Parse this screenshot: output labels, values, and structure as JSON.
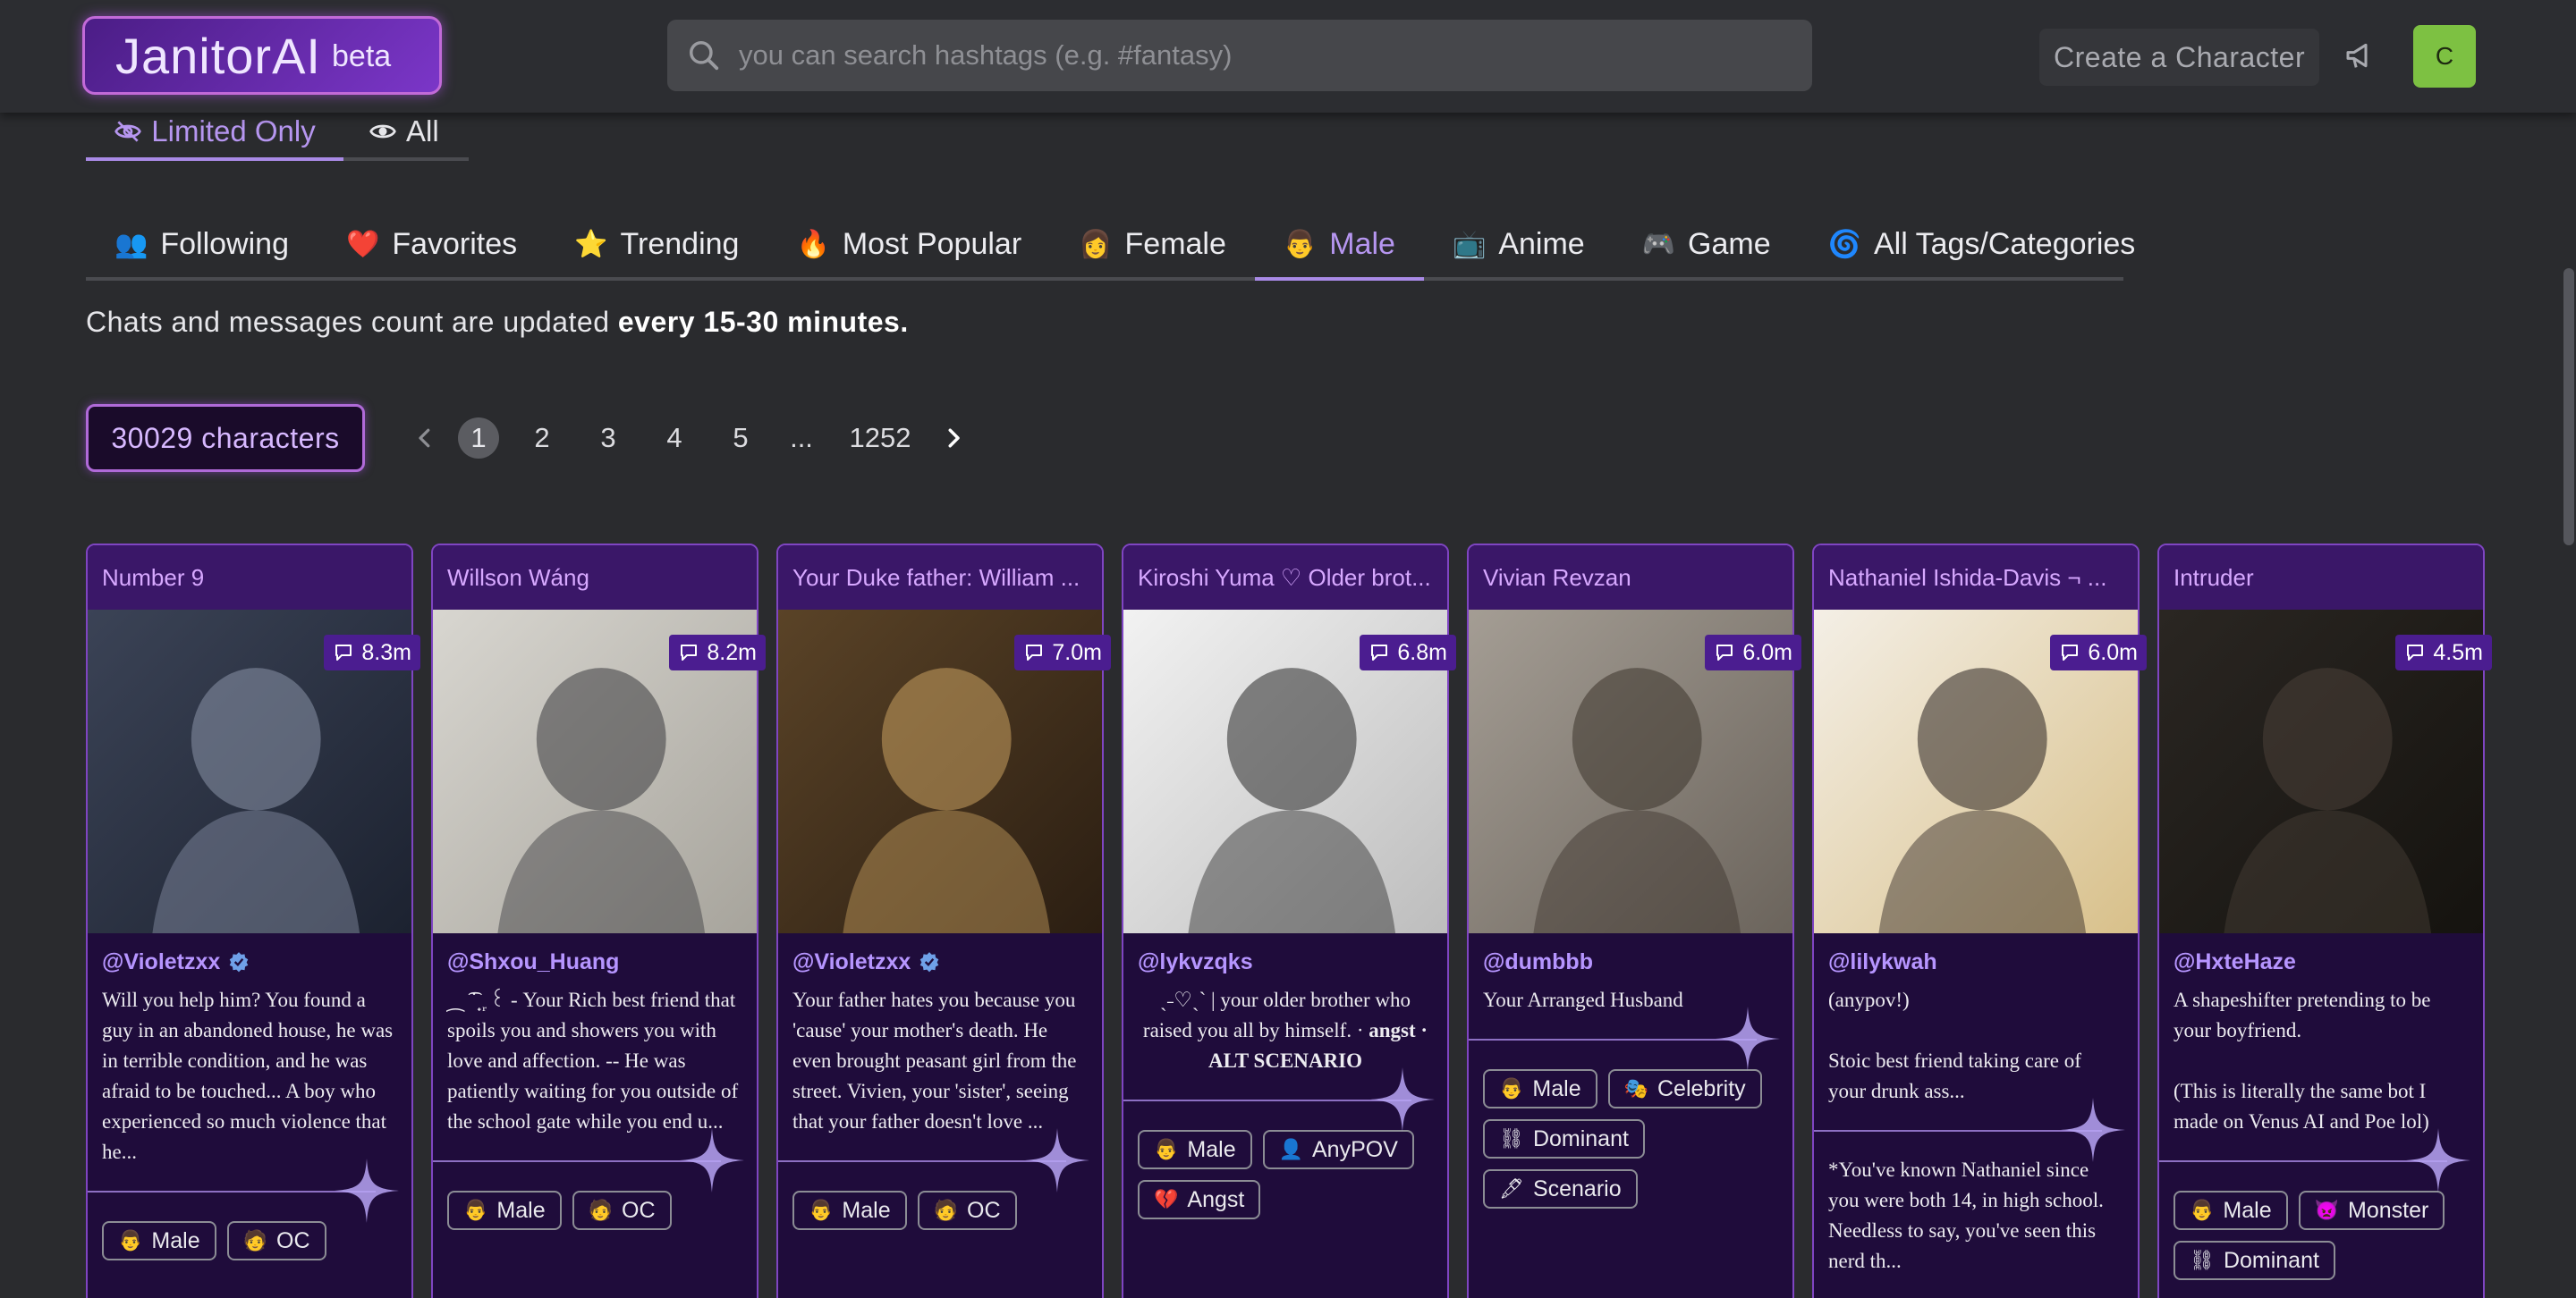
{
  "header": {
    "logo_name": "JanitorAI",
    "logo_beta": "beta",
    "search_placeholder": "you can search hashtags (e.g. #fantasy)",
    "create_label": "Create a Character",
    "avatar_letter": "C"
  },
  "limit_tabs": {
    "limited": "Limited Only",
    "all": "All"
  },
  "category_tabs": [
    {
      "emoji": "👥",
      "label": "Following"
    },
    {
      "emoji": "❤️",
      "label": "Favorites"
    },
    {
      "emoji": "⭐",
      "label": "Trending"
    },
    {
      "emoji": "🔥",
      "label": "Most Popular"
    },
    {
      "emoji": "👩",
      "label": "Female"
    },
    {
      "emoji": "👨",
      "label": "Male"
    },
    {
      "emoji": "📺",
      "label": "Anime"
    },
    {
      "emoji": "🎮",
      "label": "Game"
    },
    {
      "emoji": "🌀",
      "label": "All Tags/Categories"
    }
  ],
  "active_tab": "Male",
  "update_note": {
    "prefix": "Chats and messages count are updated ",
    "bold": "every 15-30 minutes."
  },
  "characters_count": "30029 characters",
  "pagination": {
    "pages": [
      "1",
      "2",
      "3",
      "4",
      "5",
      "...",
      "1252"
    ],
    "current": "1"
  },
  "cards": [
    {
      "name": "Number 9",
      "count": "8.3m",
      "creator": "@Violetzxx",
      "verified": true,
      "description": "Will you help him? You found a guy in an abandoned house, he was in terrible condition, and he was afraid to be touched... A boy who experienced so much violence that he...",
      "tags": [
        {
          "icon": "👨",
          "label": "Male"
        },
        {
          "icon": "🧑",
          "label": "OC"
        }
      ]
    },
    {
      "name": "Willson Wáng",
      "count": "8.2m",
      "creator": "@Shxou_Huang",
      "verified": false,
      "description": "⁔ ͡ ̇ ̟ ᷊ ꒰ - Your Rich best friend that spoils you and showers you with love and affection. -- He was patiently waiting for you outside of the school gate while you end u...",
      "tags": [
        {
          "icon": "👨",
          "label": "Male"
        },
        {
          "icon": "🧑",
          "label": "OC"
        }
      ]
    },
    {
      "name": "Your Duke father: William ...",
      "count": "7.0m",
      "creator": "@Violetzxx",
      "verified": true,
      "description": "Your father hates you because you 'cause' your mother's death. He even brought peasant girl from the street. Vivien, your 'sister', seeing that your father doesn't love ...",
      "tags": [
        {
          "icon": "👨",
          "label": "Male"
        },
        {
          "icon": "🧑",
          "label": "OC"
        }
      ]
    },
    {
      "name": "Kiroshi Yuma ♡ Older brot...",
      "count": "6.8m",
      "creator": "@lykvzqks",
      "verified": false,
      "description": "ˎ˗♡ˏˋ | your older brother who raised you all by himself. ·",
      "description_bold": "angst · ALT SCENARIO",
      "tags": [
        {
          "icon": "👨",
          "label": "Male"
        },
        {
          "icon": "👤",
          "label": "AnyPOV"
        },
        {
          "icon": "💔",
          "label": "Angst"
        }
      ]
    },
    {
      "name": "Vivian Revzan",
      "count": "6.0m",
      "creator": "@dumbbb",
      "verified": false,
      "description": "Your Arranged Husband",
      "tags": [
        {
          "icon": "👨",
          "label": "Male"
        },
        {
          "icon": "🎭",
          "label": "Celebrity"
        },
        {
          "icon": "⛓",
          "label": "Dominant"
        },
        {
          "icon": "🖋",
          "label": "Scenario"
        }
      ]
    },
    {
      "name": "Nathaniel Ishida-Davis ¬ ...",
      "count": "6.0m",
      "creator": "@lilykwah",
      "verified": false,
      "description": "(anypov!)\n\nStoic best friend taking care of your drunk ass...",
      "description2": "*You've known Nathaniel since you were both 14, in high school. Needless to say, you've seen this nerd th...",
      "tags": []
    },
    {
      "name": "Intruder",
      "count": "4.5m",
      "creator": "@HxteHaze",
      "verified": false,
      "description": "A shapeshifter pretending to be your boyfriend.\n\n(This is literally the same bot I made on Venus AI and Poe lol)",
      "tags": [
        {
          "icon": "👨",
          "label": "Male"
        },
        {
          "icon": "👿",
          "label": "Monster"
        },
        {
          "icon": "⛓",
          "label": "Dominant"
        }
      ]
    }
  ],
  "colors": {
    "accent": "#b696f0",
    "card_bg": "#1f0c3b",
    "card_head": "#3a1768",
    "page_bg": "#2a2b2e"
  },
  "icons": {
    "search": "search-icon",
    "announce": "megaphone-icon",
    "chat": "chat-bubble-icon",
    "verified": "verified-badge-icon"
  }
}
